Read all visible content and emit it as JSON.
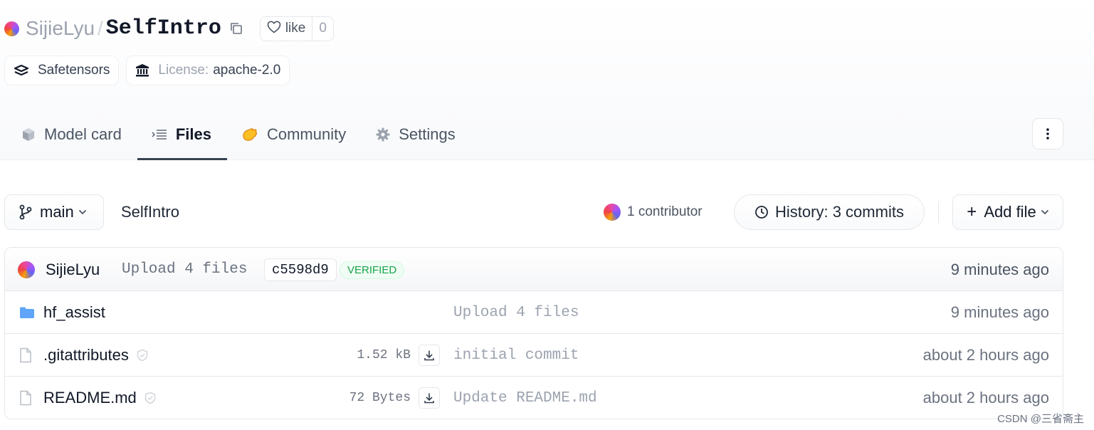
{
  "repo": {
    "owner": "SijieLyu",
    "separator": "/",
    "name": "SelfIntro",
    "like_label": "like",
    "like_count": "0"
  },
  "tags": [
    {
      "label": "Safetensors",
      "icon": "layers-icon"
    },
    {
      "prefix": "License:",
      "label": "apache-2.0",
      "icon": "bank-icon"
    }
  ],
  "tabs": [
    {
      "label": "Model card",
      "icon": "cube-icon"
    },
    {
      "label": "Files",
      "icon": "files-icon",
      "active": true
    },
    {
      "label": "Community",
      "icon": "wave-hand-icon"
    },
    {
      "label": "Settings",
      "icon": "gear-icon"
    }
  ],
  "toolbar": {
    "branch": "main",
    "breadcrumb": "SelfIntro",
    "contributors": "1 contributor",
    "history": "History: 3 commits",
    "add_file": "Add file"
  },
  "last_commit": {
    "author": "SijieLyu",
    "message": "Upload 4 files",
    "hash": "c5598d9",
    "badge": "VERIFIED",
    "time": "9 minutes ago"
  },
  "files": [
    {
      "type": "folder",
      "name": "hf_assist",
      "size": "",
      "message": "Upload 4 files",
      "time": "9 minutes ago"
    },
    {
      "type": "file",
      "name": ".gitattributes",
      "size": "1.52 kB",
      "message": "initial commit",
      "time": "about 2 hours ago"
    },
    {
      "type": "file",
      "name": "README.md",
      "size": "72 Bytes",
      "message": "Update README.md",
      "time": "about 2 hours ago"
    }
  ],
  "watermark": "CSDN @三省斋主",
  "colors": {
    "accent_green": "#16a34a",
    "folder_blue": "#60a5fa",
    "tab_underline": "#374151"
  }
}
